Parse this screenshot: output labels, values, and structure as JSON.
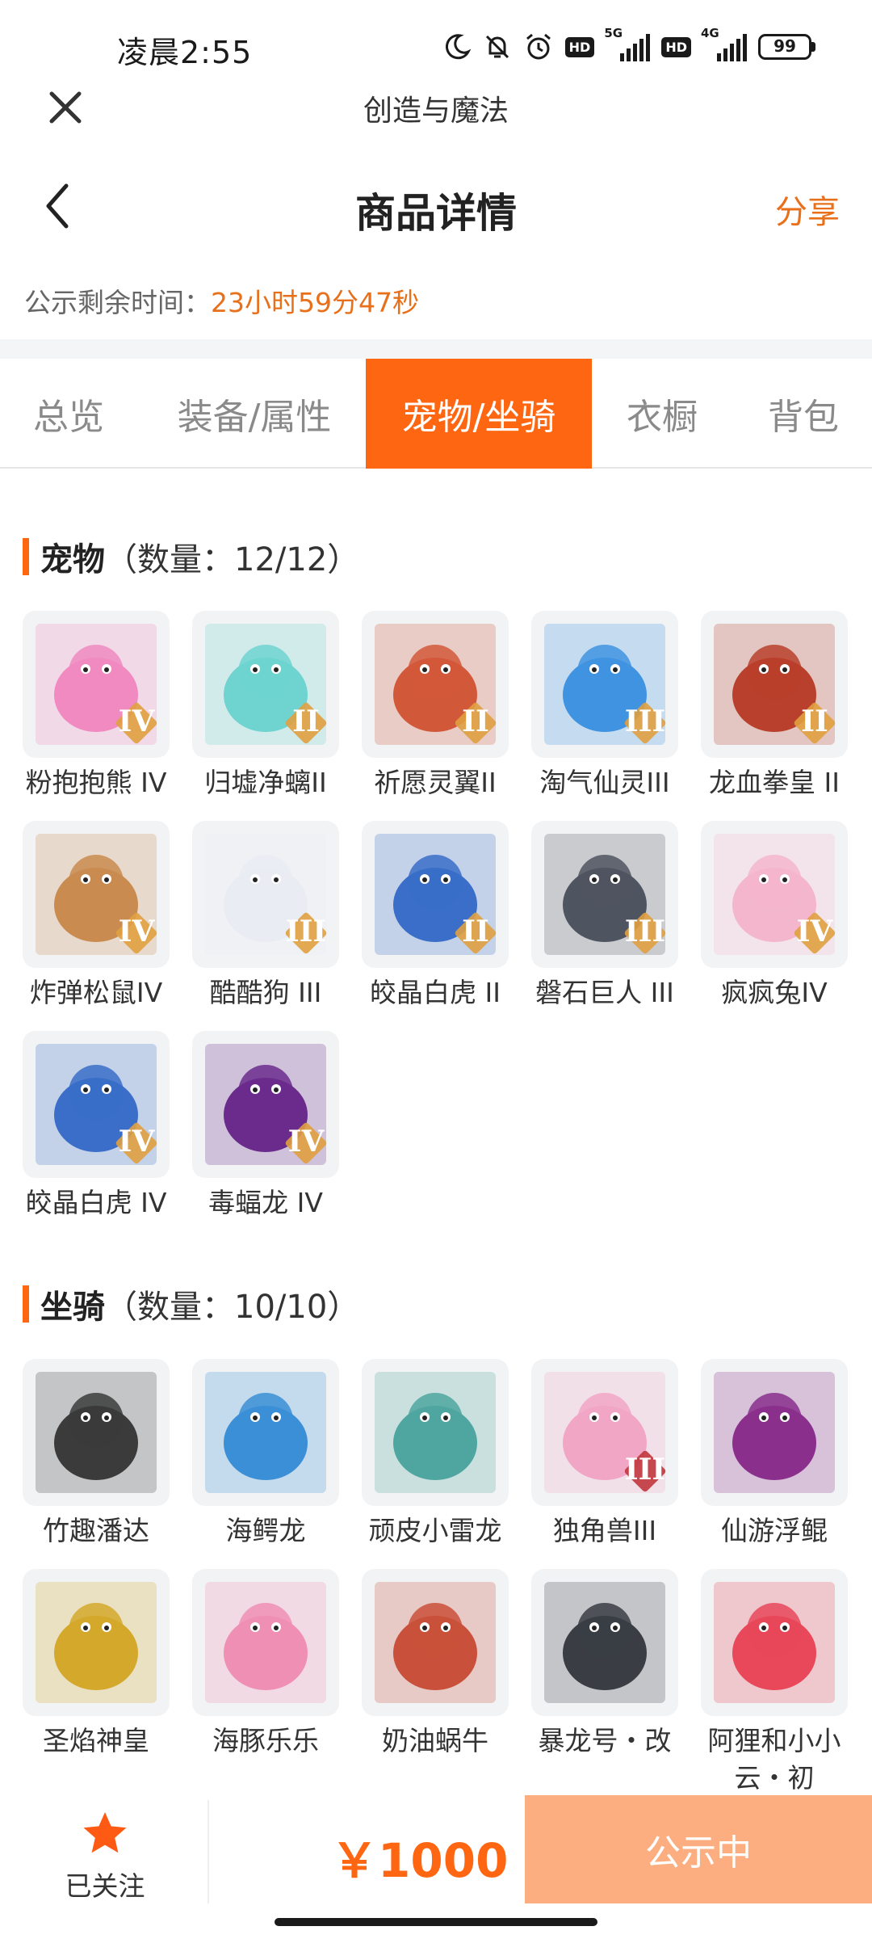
{
  "status_bar": {
    "time": "凌晨2:55",
    "hd1": "HD",
    "net1": "5G",
    "hd2": "HD",
    "net2": "4G",
    "battery": "99",
    "icons": [
      "moon-icon",
      "bell-off-icon",
      "alarm-icon"
    ]
  },
  "app": {
    "title": "创造与魔法"
  },
  "header": {
    "title": "商品详情",
    "share": "分享"
  },
  "countdown": {
    "label": "公示剩余时间：",
    "value": "23小时59分47秒"
  },
  "tabs": [
    {
      "label": "总览",
      "active": false
    },
    {
      "label": "装备/属性",
      "active": false
    },
    {
      "label": "宠物/坐骑",
      "active": true
    },
    {
      "label": "衣橱",
      "active": false
    },
    {
      "label": "背包",
      "active": false
    }
  ],
  "pets": {
    "title": "宠物",
    "count": "（数量：12/12）",
    "items": [
      {
        "name": "粉抱抱熊 IV",
        "tier": "IV",
        "color": "#f08ac0"
      },
      {
        "name": "归墟净螭II",
        "tier": "II",
        "color": "#6fd3d0"
      },
      {
        "name": "祈愿灵翼II",
        "tier": "II",
        "color": "#d2583a"
      },
      {
        "name": "淘气仙灵III",
        "tier": "III",
        "color": "#3f93e0"
      },
      {
        "name": "龙血拳皇 II",
        "tier": "II",
        "color": "#b8402c"
      },
      {
        "name": "炸弹松鼠IV",
        "tier": "IV",
        "color": "#c98b50"
      },
      {
        "name": "酷酷狗 III",
        "tier": "III",
        "color": "#e9ecf2"
      },
      {
        "name": "皎晶白虎 II",
        "tier": "II",
        "color": "#3a6ec8"
      },
      {
        "name": "磐石巨人 III",
        "tier": "III",
        "color": "#4f5560"
      },
      {
        "name": "疯疯兔IV",
        "tier": "IV",
        "color": "#f4b6cc"
      },
      {
        "name": "皎晶白虎 IV",
        "tier": "IV",
        "color": "#3a6ec8"
      },
      {
        "name": "毒蝠龙 IV",
        "tier": "IV",
        "color": "#6b2b8c"
      }
    ]
  },
  "mounts": {
    "title": "坐骑",
    "count": "（数量：10/10）",
    "items": [
      {
        "name": "竹趣潘达",
        "tier": "",
        "color": "#3b3b3b"
      },
      {
        "name": "海鳄龙",
        "tier": "",
        "color": "#3b8fd6"
      },
      {
        "name": "顽皮小雷龙",
        "tier": "",
        "color": "#4fa6a0"
      },
      {
        "name": "独角兽III",
        "tier": "III",
        "color": "#f2a6c6"
      },
      {
        "name": "仙游浮鲲",
        "tier": "",
        "color": "#8a2f8c"
      },
      {
        "name": "圣焰神皇",
        "tier": "",
        "color": "#d4a82a"
      },
      {
        "name": "海豚乐乐",
        "tier": "",
        "color": "#f08fb4"
      },
      {
        "name": "奶油蜗牛",
        "tier": "",
        "color": "#c9503a"
      },
      {
        "name": "暴龙号・改",
        "tier": "",
        "color": "#3a3d44"
      },
      {
        "name": "阿狸和小小云・初",
        "tier": "",
        "color": "#e8485a"
      }
    ]
  },
  "bottom": {
    "follow_label": "已关注",
    "price": "￥1000",
    "status_button": "公示中"
  },
  "colors": {
    "accent": "#ff6611",
    "accent_text": "#e8701b",
    "button_disabled": "#fdae80"
  }
}
